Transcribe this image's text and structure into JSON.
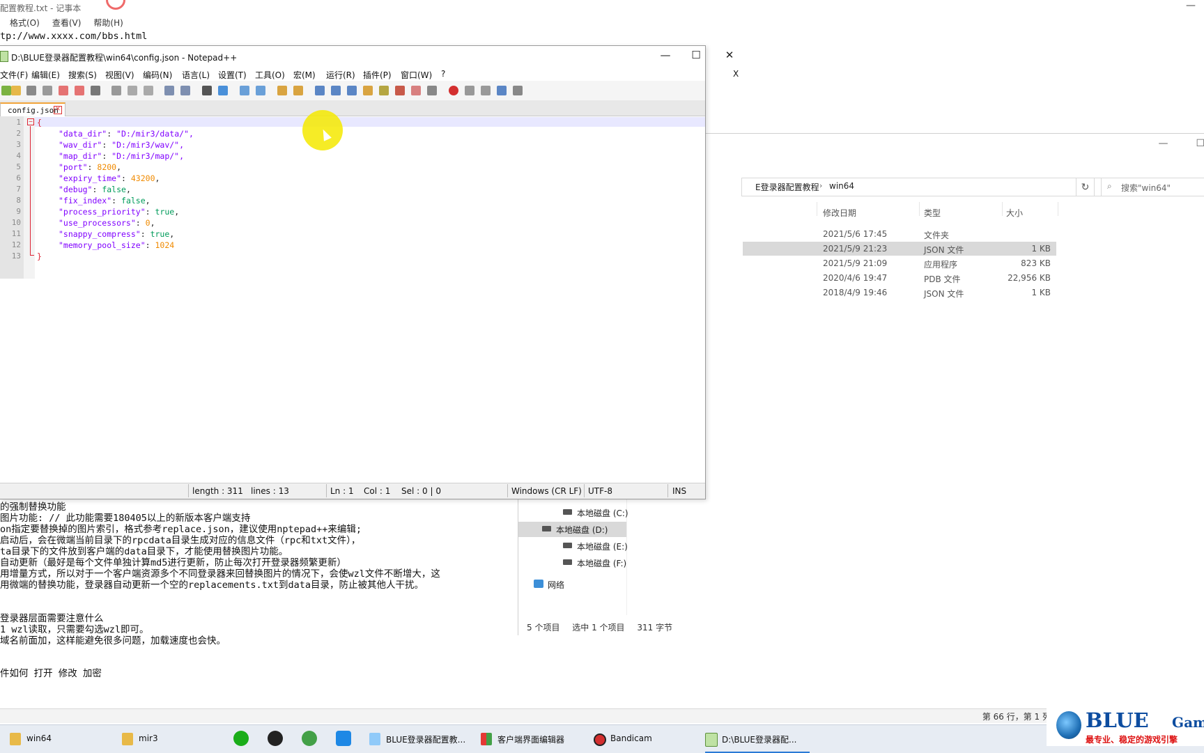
{
  "notepad": {
    "title": "配置教程.txt - 记事本",
    "menu": [
      "格式(O)",
      "查看(V)",
      "帮助(H)"
    ],
    "top_lines": [
      "tp://www.xxxx.com/bbs.html"
    ],
    "body_lines": [
      "的强制替换功能",
      "图片功能:          // 此功能需要180405以上的新版本客户端支持",
      "on指定要替换掉的图片索引，格式参考replace.json，建议使用nptepad++来编辑;",
      "启动后，会在微端当前目录下的rpcdata目录生成对应的信息文件（rpc和txt文件），",
      "ta目录下的文件放到客户端的data目录下，才能使用替换图片功能。",
      "自动更新（最好是每个文件单独计算md5进行更新，防止每次打开登录器频繁更新）",
      "用增量方式，所以对于一个客户端资源多个不同登录器来回替换图片的情况下，会使wzl文件不断增大，这",
      "用微端的替换功能，登录器自动更新一个空的replacements.txt到data目录，防止被其他人干扰。",
      "",
      "",
      "登录器层面需要注意什么",
      "1 wzl读取，只需要勾选wzl即可。",
      "域名前面加，这样能避免很多问题，加载速度也会快。",
      "",
      "",
      "件如何 打开 修改 加密"
    ],
    "status": "第 66 行，第 1 列"
  },
  "explorer": {
    "crumb1": "E登录器配置教程",
    "crumb2": "win64",
    "search_placeholder": "搜索\"win64\"",
    "columns": [
      "修改日期",
      "类型",
      "大小"
    ],
    "rows": [
      {
        "date": "2021/5/6 17:45",
        "type": "文件夹",
        "size": ""
      },
      {
        "date": "2021/5/9 21:23",
        "type": "JSON 文件",
        "size": "1 KB"
      },
      {
        "date": "2021/5/9 21:09",
        "type": "应用程序",
        "size": "823 KB"
      },
      {
        "date": "2020/4/6 19:47",
        "type": "PDB 文件",
        "size": "22,956 KB"
      },
      {
        "date": "2018/4/9 19:46",
        "type": "JSON 文件",
        "size": "1 KB"
      }
    ],
    "tree": [
      {
        "label": "本地磁盘 (C:)"
      },
      {
        "label": "本地磁盘 (D:)"
      },
      {
        "label": "本地磁盘 (E:)"
      },
      {
        "label": "本地磁盘 (F:)"
      }
    ],
    "network": "网络",
    "status": [
      "5 个项目",
      "选中 1 个项目",
      "311 字节"
    ]
  },
  "npp": {
    "title": "D:\\BLUE登录器配置教程\\win64\\config.json - Notepad++",
    "menu": [
      "文件(F)",
      "编辑(E)",
      "搜索(S)",
      "视图(V)",
      "编码(N)",
      "语言(L)",
      "设置(T)",
      "工具(O)",
      "宏(M)",
      "运行(R)",
      "插件(P)",
      "窗口(W)",
      "?"
    ],
    "close_doc": "X",
    "tab": "config.json",
    "line_numbers": [
      "1",
      "2",
      "3",
      "4",
      "5",
      "6",
      "7",
      "8",
      "9",
      "10",
      "11",
      "12",
      "13"
    ],
    "code": {
      "open": "{",
      "close": "}",
      "entries": [
        {
          "key": "\"data_dir\"",
          "val": "\"D:/mir3/data/\","
        },
        {
          "key": "\"wav_dir\"",
          "val": "\"D:/mir3/wav/\","
        },
        {
          "key": "\"map_dir\"",
          "val": "\"D:/mir3/map/\","
        },
        {
          "key": "\"port\"",
          "val": "8200"
        },
        {
          "key": "\"expiry_time\"",
          "val": "43200"
        },
        {
          "key": "\"debug\"",
          "val": "false"
        },
        {
          "key": "\"fix_index\"",
          "val": "false"
        },
        {
          "key": "\"process_priority\"",
          "val": "true"
        },
        {
          "key": "\"use_processors\"",
          "val": "0"
        },
        {
          "key": "\"snappy_compress\"",
          "val": "true"
        },
        {
          "key": "\"memory_pool_size\"",
          "val": "1024"
        }
      ]
    },
    "status": {
      "length": "length : 311",
      "lines": "lines : 13",
      "ln": "Ln : 1",
      "col": "Col : 1",
      "sel": "Sel : 0 | 0",
      "eol": "Windows (CR LF)",
      "enc": "UTF-8",
      "mode": "INS"
    }
  },
  "taskbar": {
    "items": [
      "win64",
      "mir3",
      "BLUE登录器配置教...",
      "客户端界面编辑器",
      "Bandicam",
      "D:\\BLUE登录器配..."
    ]
  },
  "logo": {
    "name": "BLUE",
    "game": "Game",
    "slogan": "最专业、稳定的游戏引擎"
  }
}
